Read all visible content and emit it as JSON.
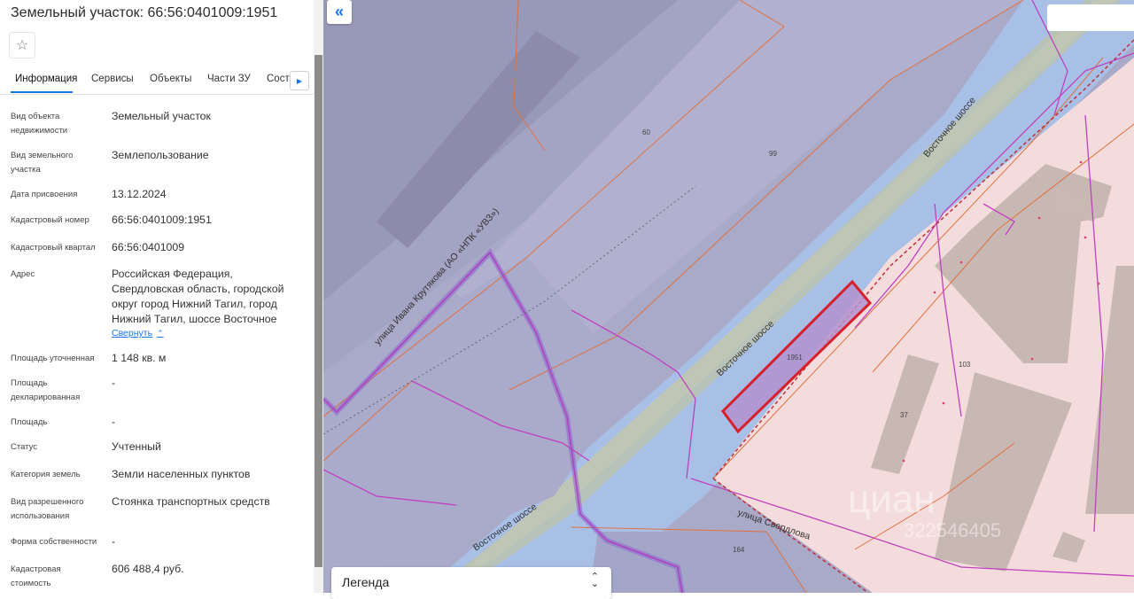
{
  "panel": {
    "title": "Земельный участок: 66:56:0401009:1951",
    "favorite_icon": "star-icon",
    "tabs": [
      {
        "label": "Информация"
      },
      {
        "label": "Сервисы"
      },
      {
        "label": "Объекты"
      },
      {
        "label": "Части ЗУ"
      },
      {
        "label": "Соста"
      }
    ],
    "tabs_next_icon": "chevron-right-icon",
    "rows": [
      {
        "label": "Вид объекта недвижимости",
        "value": "Земельный участок"
      },
      {
        "label": "Вид земельного участка",
        "value": "Землепользование"
      },
      {
        "label": "Дата присвоения",
        "value": "13.12.2024"
      },
      {
        "label": "Кадастровый номер",
        "value": "66:56:0401009:1951"
      },
      {
        "label": "Кадастровый квартал",
        "value": "66:56:0401009"
      },
      {
        "label": "Адрес",
        "value": "Российская Федерация, Свердловская область, городской округ город Нижний Тагил, город Нижний Тагил, шоссе Восточное"
      },
      {
        "label": "Площадь уточненная",
        "value": "1 148 кв. м"
      },
      {
        "label": "Площадь декларированная",
        "value": "-"
      },
      {
        "label": "Площадь",
        "value": "-"
      },
      {
        "label": "Статус",
        "value": "Учтенный"
      },
      {
        "label": "Категория земель",
        "value": "Земли населенных пунктов"
      },
      {
        "label": "Вид разрешенного использования",
        "value": "Стоянка транспортных средств"
      },
      {
        "label": "Форма собственности",
        "value": "-"
      },
      {
        "label": "Кадастровая стоимость",
        "value": "606 488,4 руб."
      }
    ],
    "collapse_label": "Свернуть"
  },
  "map": {
    "collapse_icon": "double-chevron-left-icon",
    "labels": {
      "street_ivana": "улица Ивана Крутякова (АО «НПК «УВЗ»)",
      "vostochnoe_top": "Восточное шоссе",
      "vostochnoe_mid": "Восточное шоссе",
      "vostochnoe_bottom": "Восточное шоссе",
      "sverdlova": "улица Свердлова",
      "lot_60": "60",
      "lot_99": "99",
      "lot_1951": "1951",
      "lot_103": "103",
      "lot_37": "37",
      "lot_164": "164",
      "watermark_brand": "циан",
      "watermark_id": "322546405"
    },
    "colors": {
      "selected_parcel": "#d8202a",
      "parcel_border": "#e0703f",
      "boundary_line": "#c040c0",
      "road": "#a9bcd0",
      "industrial_zone": "#f6dada"
    }
  },
  "legend": {
    "label": "Легенда",
    "toggle_icon": "expand-collapse-icon"
  }
}
